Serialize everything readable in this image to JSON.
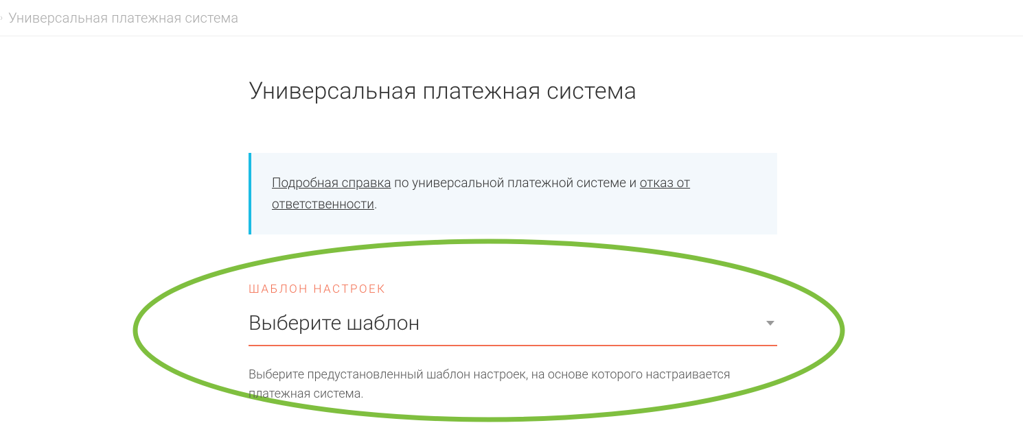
{
  "breadcrumb": {
    "current": "Универсальная платежная система"
  },
  "page": {
    "title": "Универсальная платежная система"
  },
  "info": {
    "link1": "Подробная справка",
    "middle": " по универсальной платежной системе и ",
    "link2": "отказ от ответственности",
    "end": "."
  },
  "template_field": {
    "label": "ШАБЛОН НАСТРОЕК",
    "placeholder": "Выберите шаблон",
    "help": "Выберите предустановленный шаблон настроек, на основе которого настраивается платежная система."
  }
}
